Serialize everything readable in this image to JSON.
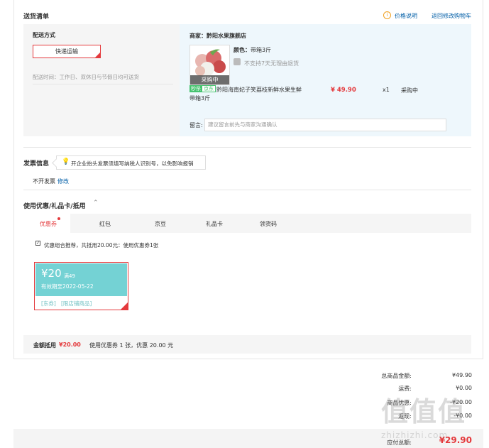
{
  "delivery": {
    "section_title": "送货清单",
    "price_note": "价格说明",
    "back_to_cart": "返回修改购物车",
    "method_label": "配送方式",
    "method_value": "快递运输",
    "time_note": "配送时间：工作日、双休日与节假日均可送货"
  },
  "order": {
    "store": "商家：黔阳水果旗舰店",
    "color_label": "颜色：",
    "color_value": "带箱3斤",
    "return_policy": "不支持7天无理由退货",
    "image_badge": "采购中",
    "tag1": "秒杀",
    "tag2": "京东",
    "product_name": "黔阳海南妃子笑荔枝新鲜水果生鲜",
    "product_spec": "带箱3斤",
    "price": "¥ 49.90",
    "qty": "x1",
    "status": "采购中",
    "message_label": "留言:",
    "message_placeholder": "建议留言前先与商家沟通确认"
  },
  "invoice": {
    "title": "发票信息",
    "tip": "开企业抬头发票须填写纳税人识别号，以免影响报销",
    "value": "不开发票",
    "edit": "修改"
  },
  "discount": {
    "title": "使用优惠/礼品卡/抵用",
    "tabs": [
      "优惠券",
      "红包",
      "京豆",
      "礼品卡",
      "领货码"
    ],
    "combo_note": "优惠组合推荐，共抵用20.00元：使用优惠券1张",
    "coupon": {
      "amount": "¥20",
      "condition": "满49",
      "validity": "有效期至2022-05-22",
      "type": "[东券]",
      "scope": "[限店铺商品]"
    },
    "footer_label": "金额抵用",
    "footer_amount": "¥20.00",
    "footer_note": "使用优惠券 1 张，优惠 20.00 元"
  },
  "summary": {
    "rows": [
      {
        "label": "总商品金额:",
        "value": "¥49.90"
      },
      {
        "label": "运费:",
        "value": "¥0.00"
      },
      {
        "label": "商品优惠:",
        "value": "-¥20.00"
      },
      {
        "label": "返现:",
        "value": "-¥0.00"
      }
    ],
    "total_label": "应付总额:",
    "total_value": "¥29.90"
  },
  "watermark": "值值值",
  "watermark_site": "zhizhizhi.com",
  "colors": {
    "accent": "#e4393c",
    "link": "#005ea7",
    "coupon": "#74d2d4"
  }
}
